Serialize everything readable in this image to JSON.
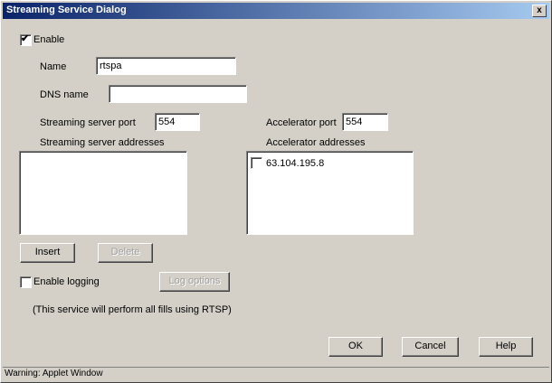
{
  "window": {
    "title": "Streaming Service Dialog",
    "close_glyph": "x"
  },
  "enable": {
    "label": "Enable",
    "checked": true
  },
  "name": {
    "label": "Name",
    "value": "rtspa"
  },
  "dns": {
    "label": "DNS name",
    "value": ""
  },
  "streaming": {
    "port_label": "Streaming server port",
    "port_value": "554",
    "addresses_label": "Streaming server addresses",
    "addresses": []
  },
  "accelerator": {
    "port_label": "Accelerator port",
    "port_value": "554",
    "addresses_label": "Accelerator addresses",
    "addresses": [
      {
        "ip": "63.104.195.8",
        "checked": false
      }
    ]
  },
  "buttons": {
    "insert": "Insert",
    "delete": "Delete",
    "log_options": "Log options",
    "ok": "OK",
    "cancel": "Cancel",
    "help": "Help"
  },
  "logging": {
    "label": "Enable logging",
    "checked": false
  },
  "note": "(This service will perform all fills using RTSP)",
  "status": "Warning: Applet Window"
}
